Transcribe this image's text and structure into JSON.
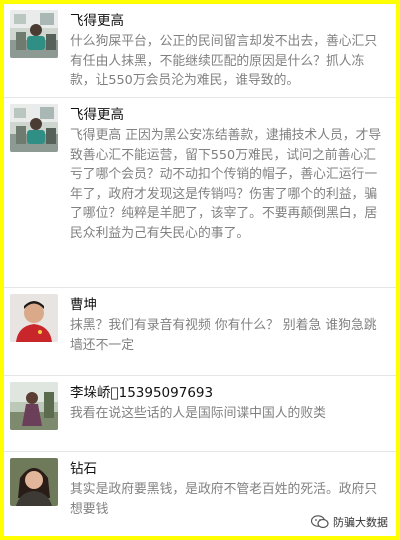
{
  "comments": [
    {
      "name": "飞得更高",
      "text": "什么狗屎平台，公正的民间留言却发不出去，善心汇只有任由人抹黑，不能继续匹配的原因是什么？抓人冻款，让550万会员沦为难民，谁导致的。",
      "avatar": "office-photo-avatar"
    },
    {
      "name": "飞得更高",
      "text": "飞得更高 正因为黑公安冻结善款，逮捕技术人员，才导致善心汇不能运营，留下550万难民，试问之前善心汇亏了哪个会员？动不动扣个传销的帽子，善心汇运行一年了，政府才发现这是传销吗？伤害了哪个的利益，骗了哪位？纯粹是羊肥了，该宰了。不要再颠倒黑白，居民众利益为己有失民心的事了。",
      "avatar": "office-photo-avatar"
    },
    {
      "name": "曹坤",
      "text": "抹黑？我们有录音有视频 你有什么？ 别着急 谁狗急跳墙还不一定",
      "avatar": "man-red-shirt-avatar"
    },
    {
      "name": "李垛峤􀀀15395097693",
      "text": "我看在说这些话的人是国际间谍中国人的败类",
      "avatar": "woman-outdoor-avatar"
    },
    {
      "name": "钻石",
      "text": "其实是政府要黑钱，是政府不管老百姓的死活。政府只想要钱",
      "avatar": "woman-portrait-avatar"
    }
  ],
  "watermark": {
    "label": "防骗大数据",
    "icon": "wechat-icon"
  }
}
